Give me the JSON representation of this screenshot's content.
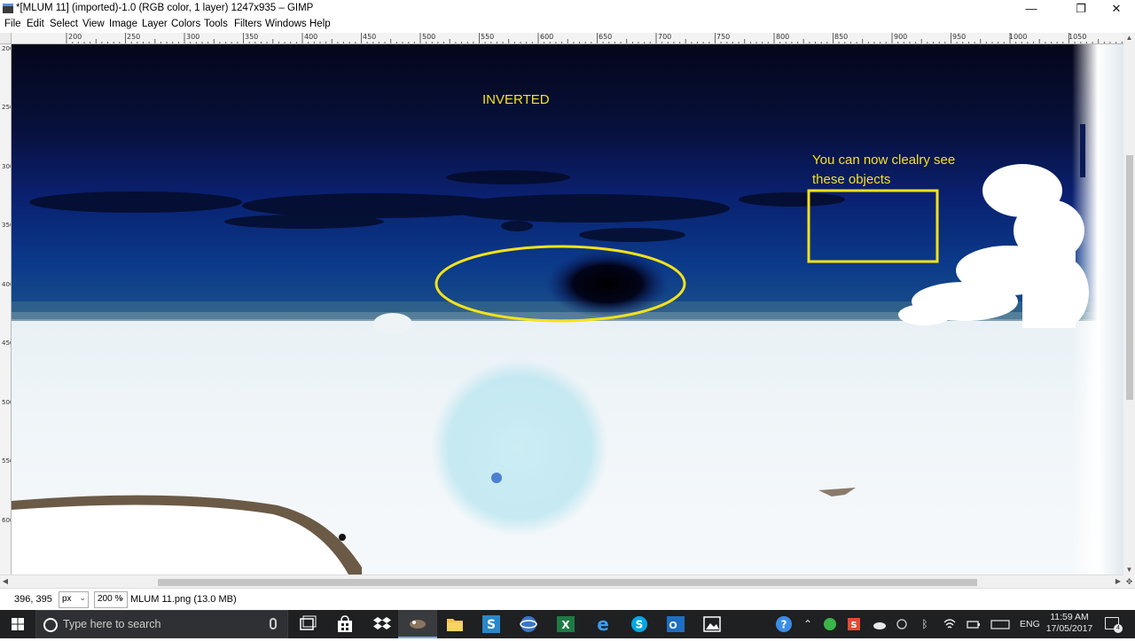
{
  "window": {
    "title": "*[MLUM 11] (imported)-1.0 (RGB color, 1 layer) 1247x935 – GIMP",
    "minimize_glyph": "—",
    "restore_glyph": "❐",
    "close_glyph": "✕"
  },
  "menu": [
    "File",
    "Edit",
    "Select",
    "View",
    "Image",
    "Layer",
    "Colors",
    "Tools",
    "Filters",
    "Windows",
    "Help"
  ],
  "ruler_top": [
    "200",
    "250",
    "300",
    "350",
    "400",
    "450",
    "500",
    "550",
    "600",
    "650",
    "700",
    "750",
    "800",
    "850",
    "900",
    "950",
    "1000",
    "1050"
  ],
  "ruler_left": [
    "200",
    "250",
    "300",
    "350",
    "400",
    "450",
    "500",
    "550",
    "600"
  ],
  "canvas": {
    "label_inverted": "INVERTED",
    "label_objects_line1": "You can now clealry see",
    "label_objects_line2": "these objects",
    "annotation_color": "#f5e21a"
  },
  "status": {
    "coords": "396, 395",
    "unit": "px",
    "zoom": "200 %",
    "file": "MLUM 11.png (13.0 MB)"
  },
  "taskbar": {
    "search_placeholder": "Type here to search",
    "language": "ENG",
    "time": "11:59 AM",
    "date": "17/05/2017",
    "notification_count": "4"
  }
}
